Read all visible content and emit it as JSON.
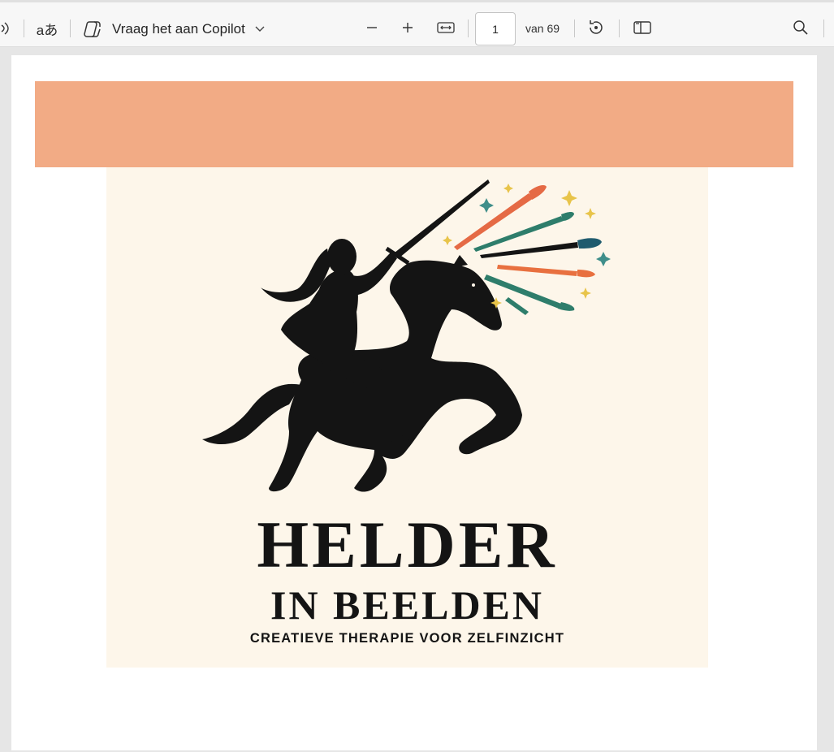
{
  "toolbar": {
    "read_aloud_icon": "read-aloud-icon",
    "translate_label": "aあ",
    "copilot_label": "Vraag het aan Copilot",
    "zoom_out_icon": "minus-icon",
    "zoom_in_icon": "plus-icon",
    "fit_icon": "fit-width-icon",
    "page_current": "1",
    "page_total_label": "van 69",
    "rotate_icon": "rotate-icon",
    "two_page_icon": "page-view-icon",
    "search_icon": "search-icon"
  },
  "document": {
    "header_band_color": "#f2ab85",
    "cover": {
      "title_line1": "HELDER",
      "title_line2": "IN BEELDEN",
      "subtitle": "CREATIEVE THERAPIE VOOR ZELFINZICHT",
      "background_color": "#fdf6ea",
      "illustration": "knight-on-horse-with-paintbrushes"
    }
  }
}
